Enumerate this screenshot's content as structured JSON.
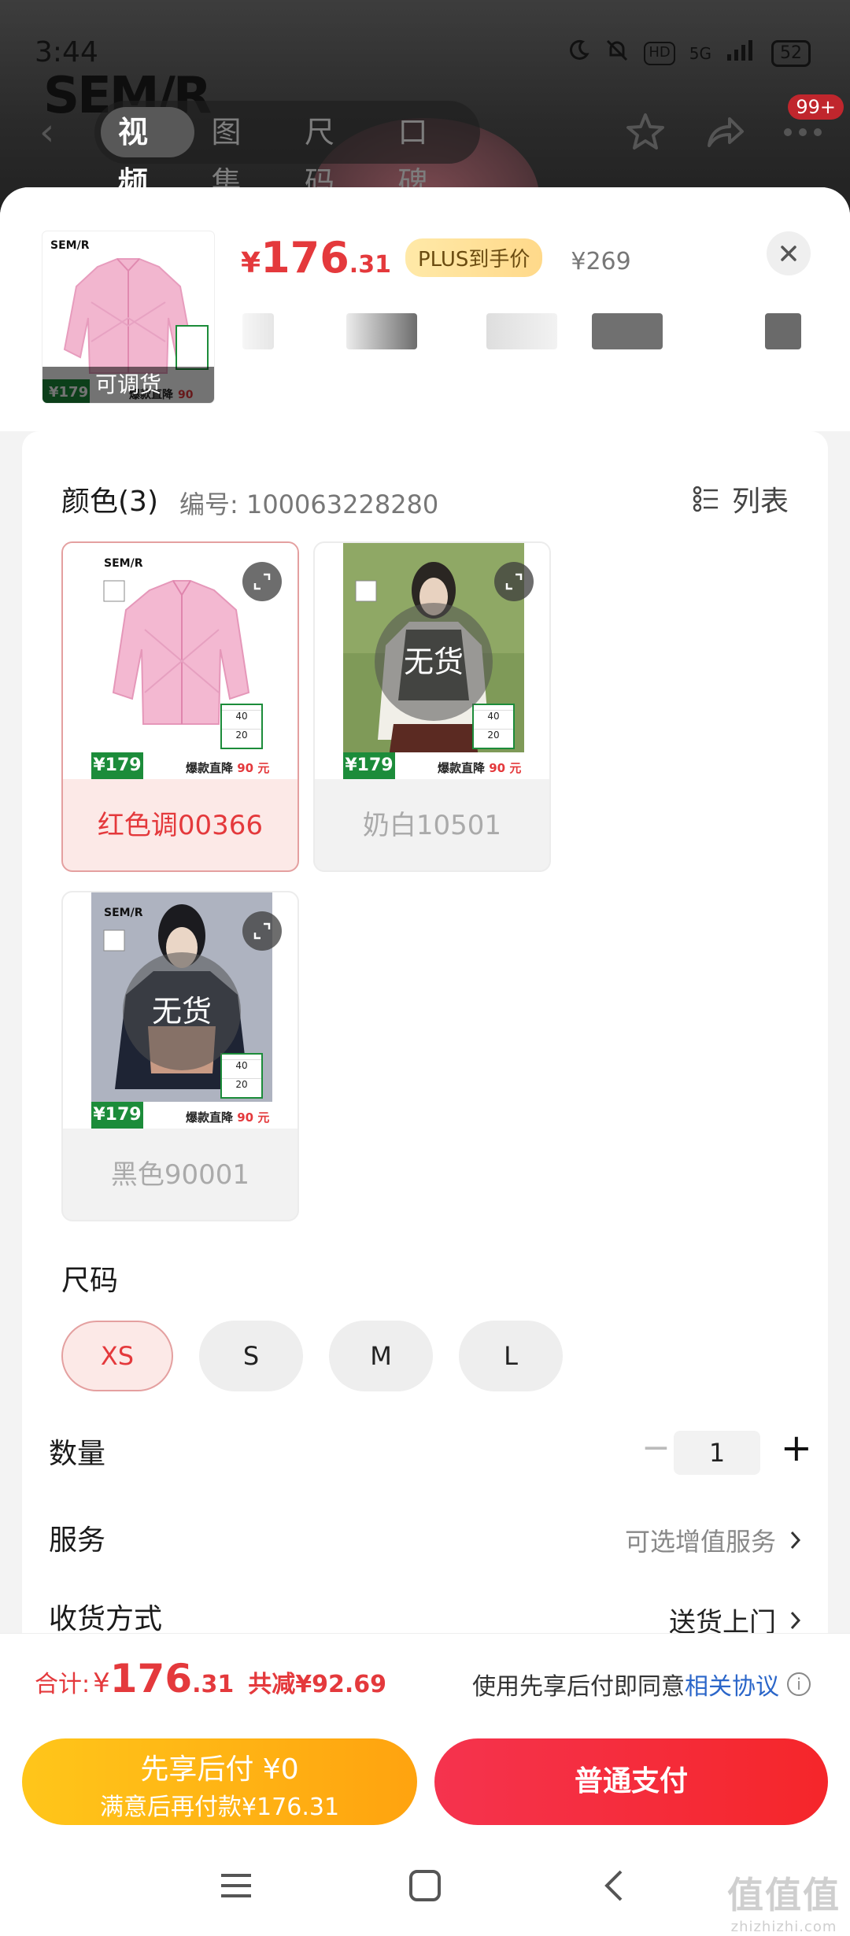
{
  "status_bar": {
    "time": "3:44",
    "network": "5G",
    "hd": "HD",
    "battery": "52"
  },
  "background": {
    "brand": "SEM/R",
    "tabs": [
      "视频",
      "图集",
      "尺码",
      "口碑"
    ],
    "active_tab": 0,
    "badge": "99+"
  },
  "header": {
    "thumb_label": "可调货",
    "price_symbol": "¥",
    "price_int": "176",
    "price_dec": ".31",
    "plus_tag": "PLUS到手价",
    "original_price": "¥269"
  },
  "color_section": {
    "title": "颜色(3)",
    "sku_code": "编号: 100063228280",
    "list_label": "列表",
    "options": [
      {
        "label": "红色调00366",
        "selected": true,
        "soldout": false,
        "brand": "SEM/R",
        "promo_price": "¥179",
        "promo_text": "爆款直降",
        "promo_amount": "90",
        "promo_unit": "元",
        "tag_a": "40",
        "tag_b": "20"
      },
      {
        "label": "奶白10501",
        "selected": false,
        "soldout": true,
        "soldout_text": "无货",
        "promo_price": "¥179",
        "promo_text": "爆款直降",
        "promo_amount": "90",
        "promo_unit": "元",
        "tag_a": "40",
        "tag_b": "20"
      },
      {
        "label": "黑色90001",
        "selected": false,
        "soldout": true,
        "soldout_text": "无货",
        "brand": "SEM/R",
        "promo_price": "¥179",
        "promo_text": "爆款直降",
        "promo_amount": "90",
        "promo_unit": "元",
        "tag_a": "40",
        "tag_b": "20"
      }
    ]
  },
  "size_section": {
    "title": "尺码",
    "sizes": [
      {
        "label": "XS",
        "selected": true
      },
      {
        "label": "S",
        "selected": false
      },
      {
        "label": "M",
        "selected": false
      },
      {
        "label": "L",
        "selected": false
      }
    ]
  },
  "quantity": {
    "label": "数量",
    "value": "1",
    "minus": "−",
    "plus": "+"
  },
  "service": {
    "label": "服务",
    "value": "可选增值服务"
  },
  "delivery": {
    "label": "收货方式",
    "value": "送货上门"
  },
  "total": {
    "label": "合计:",
    "symbol": "¥",
    "int": "176",
    "dec": ".31",
    "discount": "共减¥92.69",
    "agree_text": "使用先享后付即同意",
    "agree_link": "相关协议"
  },
  "buttons": {
    "pay_later_line1": "先享后付 ¥0",
    "pay_later_line2": "满意后再付款¥176.31",
    "pay_now": "普通支付"
  },
  "watermark": {
    "main": "值值值",
    "sub": "zhizhizhi.com"
  },
  "colors": {
    "accent": "#e4393c",
    "pay_later": "#ffb414",
    "pay_now": "#f52a3a",
    "link": "#2b66c9"
  }
}
